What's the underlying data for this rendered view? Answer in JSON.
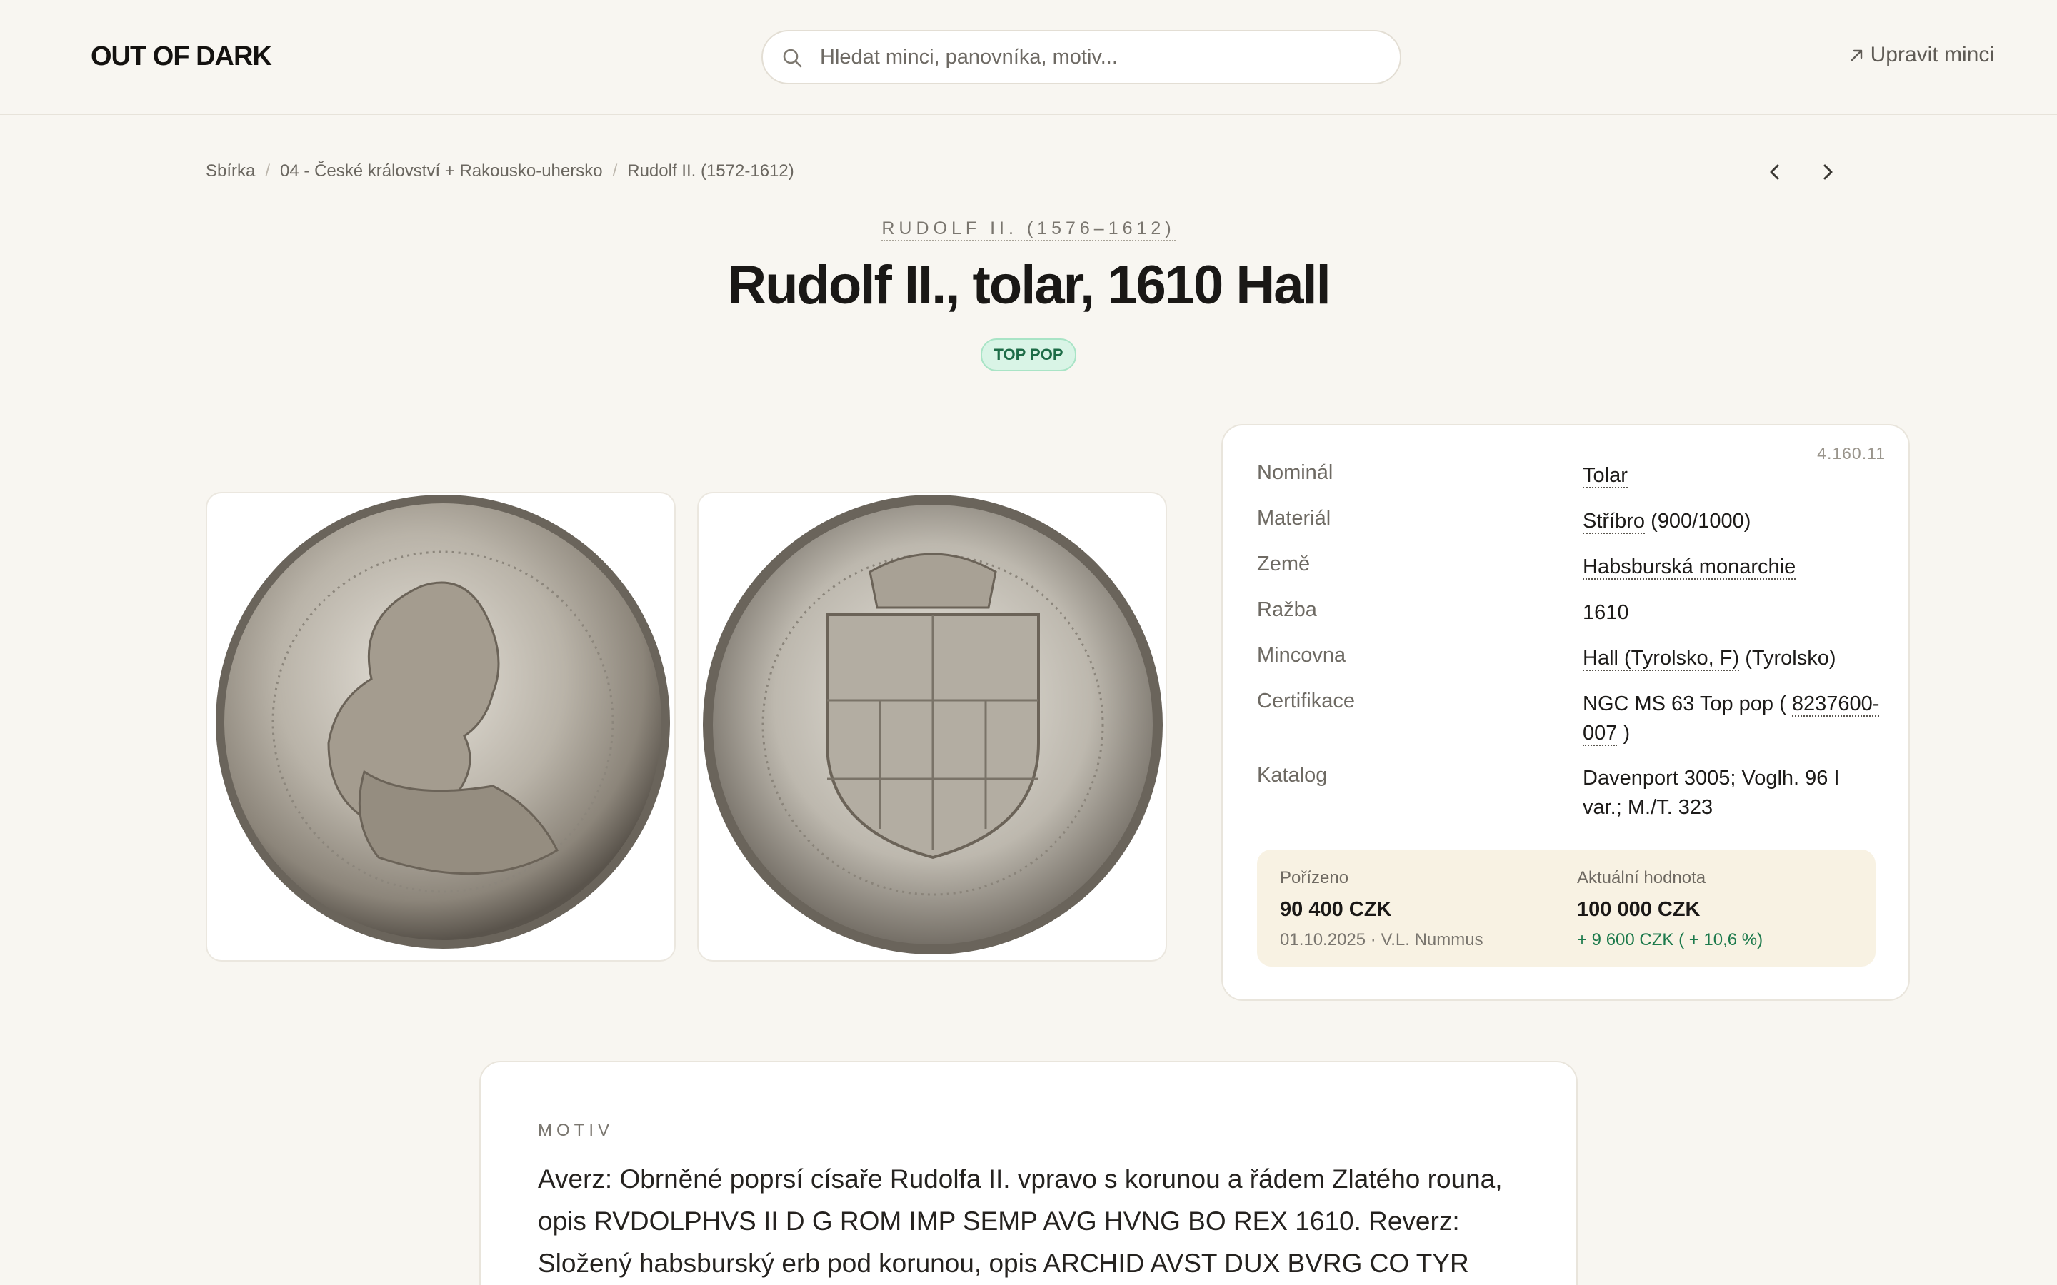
{
  "header": {
    "logo": "OUT OF DARK",
    "search_placeholder": "Hledat minci, panovníka, motiv...",
    "edit_label": "Upravit minci"
  },
  "breadcrumb": [
    "Sbírka",
    "04 - České království + Rakousko-uhersko",
    "Rudolf II. (1572-1612)"
  ],
  "coin": {
    "ruler": "RUDOLF II. (1576–1612)",
    "title": "Rudolf II., tolar, 1610 Hall",
    "badge": "TOP POP"
  },
  "details": {
    "catalog_id": "4.160.11",
    "rows": [
      {
        "label": "Nominál",
        "value": "Tolar"
      },
      {
        "label": "Materiál",
        "value": "Stříbro",
        "extra": " (900/1000)"
      },
      {
        "label": "Země",
        "value": "Habsburská monarchie"
      },
      {
        "label": "Ražba",
        "value": "1610"
      },
      {
        "label": "Mincovna",
        "value": "Hall (Tyrolsko, F)",
        "extra": " (Tyrolsko)"
      },
      {
        "label": "Certifikace",
        "value_prefix": "NGC MS 63 Top pop (",
        "value": "8237600-007",
        "extra": " )"
      },
      {
        "label": "Katalog",
        "value": "Davenport 3005; Voglh. 96 I var.; M./T. 323"
      }
    ]
  },
  "price": {
    "acquired_label": "Pořízeno",
    "acquired_value": "90 400 CZK",
    "acquired_meta": "01.10.2025 · V.L. Nummus",
    "current_label": "Aktuální hodnota",
    "current_value": "100 000 CZK",
    "gain": "+ 9 600 CZK ( + 10,6 %)"
  },
  "motiv": {
    "label": "MOTIV",
    "text": "Averz: Obrněné poprsí císaře Rudolfa II. vpravo s korunou a řádem Zlatého rouna, opis RVDOLPHVS II D G ROM IMP SEMP AVG HVNG BO REX 1610. Reverz: Složený habsburský erb pod korunou, opis ARCHID AVST DUX BVRG CO TYR"
  },
  "colors": {
    "background": "#f8f6f1",
    "badge_bg": "#d9f4e6",
    "badge_text": "#1d6c47",
    "gain": "#1d7a4c",
    "price_box": "#f8f2e3"
  }
}
